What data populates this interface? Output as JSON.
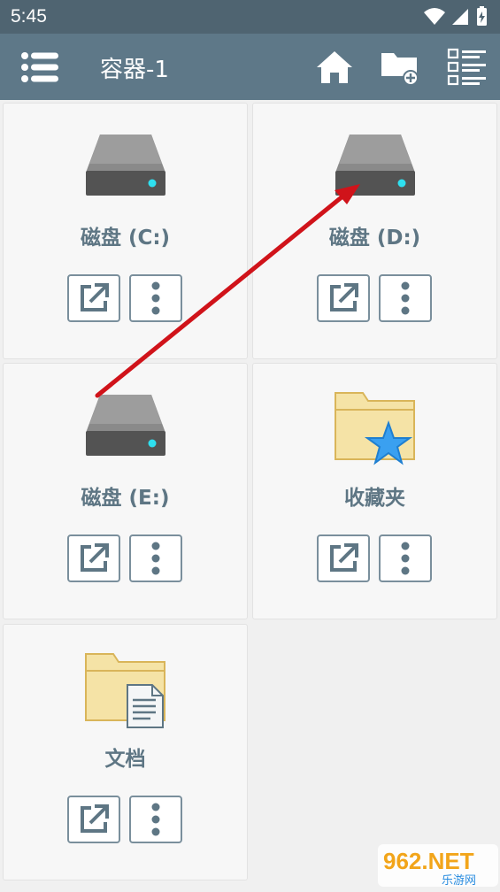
{
  "status": {
    "time": "5:45"
  },
  "toolbar": {
    "title": "容器-1"
  },
  "items": [
    {
      "label": "磁盘 (C:)",
      "type": "drive"
    },
    {
      "label": "磁盘 (D:)",
      "type": "drive"
    },
    {
      "label": "磁盘 (E:)",
      "type": "drive"
    },
    {
      "label": "收藏夹",
      "type": "favorites"
    },
    {
      "label": "文档",
      "type": "documents"
    }
  ],
  "watermark": {
    "text": "962.NET",
    "subtext": "乐游网"
  },
  "colors": {
    "statusbar": "#4f6471",
    "toolbar": "#5e7888",
    "label": "#5e7684",
    "annotation_arrow": "#d0131a"
  }
}
